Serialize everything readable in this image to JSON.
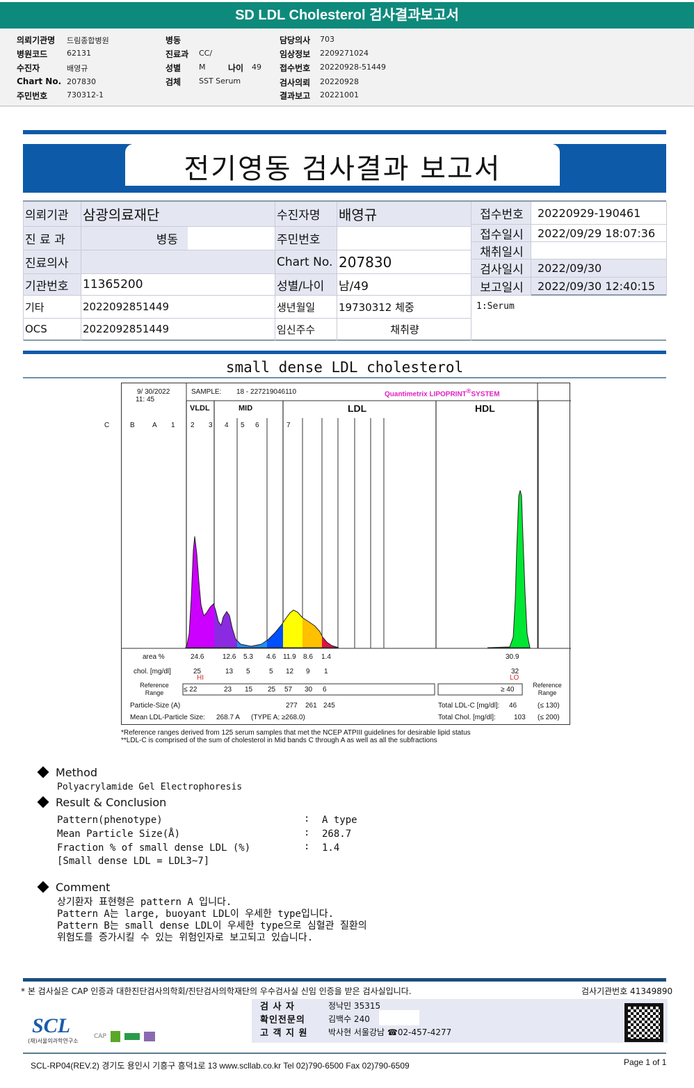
{
  "header": {
    "title": "SD LDL Cholesterol 검사결과보고서"
  },
  "meta": {
    "col1": [
      {
        "label": "의뢰기관명",
        "value": "드림종합병원"
      },
      {
        "label": "병원코드",
        "value": "62131"
      },
      {
        "label": "수진자",
        "value": "배영규"
      },
      {
        "label": "Chart No.",
        "value": "207830"
      },
      {
        "label": "주민번호",
        "value": "730312-1"
      }
    ],
    "col2": [
      {
        "label": "병동",
        "value": ""
      },
      {
        "label": "진료과",
        "value": "CC/"
      },
      {
        "label": "성별",
        "value": "M"
      },
      {
        "label": "검체",
        "value": "SST Serum"
      }
    ],
    "age": {
      "label": "나이",
      "value": "49"
    },
    "col3": [
      {
        "label": "담당의사",
        "value": "703"
      },
      {
        "label": "임상정보",
        "value": "2209271024"
      },
      {
        "label": "접수번호",
        "value": "20220928-51449"
      },
      {
        "label": "검사의뢰",
        "value": "20220928"
      },
      {
        "label": "결과보고",
        "value": "20221001"
      }
    ]
  },
  "report": {
    "title": "전기영동 검사결과 보고서"
  },
  "info": {
    "rows": [
      {
        "l1": "의뢰기관",
        "v1": "삼광의료재단",
        "l2": "수진자명",
        "v2": "배영규"
      },
      {
        "l1": "진 료 과",
        "v1": "병동",
        "l2": "주민번호",
        "v2": ""
      },
      {
        "l1": "진료의사",
        "v1": "",
        "l2": "Chart No.",
        "v2": "207830"
      },
      {
        "l1": "기관번호",
        "v1": "11365200",
        "l2": "성별/나이",
        "v2": "남/49"
      },
      {
        "l1": "기타",
        "v1": "2022092851449",
        "l2": "생년월일",
        "v2": "19730312 체중"
      },
      {
        "l1": "OCS",
        "v1": "2022092851449",
        "l2": "임신주수",
        "v2": "채취량"
      }
    ],
    "right": [
      {
        "label": "접수번호",
        "value": "20220929-190461"
      },
      {
        "label": "접수일시",
        "value": "2022/09/29 18:07:36"
      },
      {
        "label": "채취일시",
        "value": ""
      },
      {
        "label": "검사일시",
        "value": "2022/09/30"
      },
      {
        "label": "보고일시",
        "value": "2022/09/30 12:40:15"
      }
    ],
    "specimen": "1:Serum"
  },
  "section_title": "small dense LDL cholesterol",
  "chart_data": {
    "type": "area",
    "datetime": "9/ 30/2022",
    "time": "11: 45",
    "sample_label": "SAMPLE:",
    "sample": "18 - 227219046110",
    "brand": "Quantimetrix LIPOPRINT",
    "brand_mark": "®",
    "brand_suffix": "SYSTEM",
    "groups": [
      "VLDL",
      "MID",
      "LDL",
      "HDL"
    ],
    "bands": [
      "C",
      "B",
      "A",
      "1",
      "2",
      "3",
      "4",
      "5",
      "6",
      "7"
    ],
    "band_colors": {
      "VLDL": "#cc00ff",
      "MID-C": "#8a2be2",
      "MID-B": "#1e90ff",
      "MID-A": "#0050ff",
      "LDL1": "#ffff00",
      "LDL2": "#ffc000",
      "LDL3": "#e0104a",
      "HDL": "#00e632"
    },
    "rows": {
      "area_label": "area %",
      "area": [
        "24.6",
        "12.6",
        "5.3",
        "4.6",
        "11.9",
        "8.6",
        "1.4"
      ],
      "area_hdl": "30.9",
      "chol_label": "chol. [mg/dl]",
      "chol": [
        "25",
        "13",
        "5",
        "5",
        "12",
        "9",
        "1"
      ],
      "chol_hdl": "32",
      "flag_vldl": "HI",
      "flag_hdl": "LO",
      "ref_label": "Reference Range",
      "ref": [
        "≤ 22",
        "23",
        "15",
        "25",
        "57",
        "30",
        "6"
      ],
      "ref_hdl": "≥  40",
      "particle_label": "Particle-Size (A)",
      "particle": [
        "277",
        "261",
        "245"
      ],
      "mean_label": "Mean LDL-Particle Size:",
      "mean_value": "268.7  A",
      "mean_type": "(TYPE A; ≥268.0)",
      "total_ldl_label": "Total LDL-C  [mg/dl]:",
      "total_ldl": "46",
      "total_ldl_ref": "(≤ 130)",
      "total_chol_label": "Total Chol.  [mg/dl]:",
      "total_chol": "103",
      "total_chol_ref": "(≤ 200)"
    },
    "notes": [
      "*Reference ranges derived from 125 serum samples that met the NCEP ATPIII guidelines for desirable lipid status",
      "**LDL-C is comprised of the sum of cholesterol in Mid bands C through A as well as all the subfractions"
    ]
  },
  "method": {
    "title": "Method",
    "text": "Polyacrylamide Gel Electrophoresis"
  },
  "result": {
    "title": "Result & Conclusion",
    "items": [
      {
        "label": "Pattern(phenotype)",
        "value": "A type"
      },
      {
        "label": "Mean Particle Size(Å)",
        "value": "268.7"
      },
      {
        "label": "Fraction % of small dense LDL (%)",
        "value": "1.4"
      }
    ],
    "note": "[Small dense LDL = LDL3~7]"
  },
  "comment": {
    "title": "Comment",
    "lines": [
      "상기환자 표현형은 pattern A 입니다.",
      "Pattern A는 large, buoyant LDL이 우세한 type입니다.",
      "Pattern B는 small dense LDL이 우세한 type으로 심혈관 질환의",
      "위험도를 증가시킬 수 있는 위험인자로 보고되고 있습니다."
    ]
  },
  "footer": {
    "cert": "* 본 검사실은 CAP 인증과 대한진단검사의학회/진단검사의학재단의 우수검사실 신임 인증을 받은 검사실입니다.",
    "lab_no": "검사기관번호 41349890",
    "staff": [
      {
        "label": "검   사   자",
        "value": "정낙민 35315"
      },
      {
        "label": "확인전문의",
        "value": "김백수 240"
      },
      {
        "label": "고 객 지 원",
        "value": "박사현 서울강남 ☎02-457-4277"
      }
    ],
    "logo": "SCL",
    "logo_sub": "(재)서울의과학연구소",
    "address": "SCL-RP04(REV.2)  경기도 용인시 기흥구 흥덕1로 13  www.scllab.co.kr   Tel 02)790-6500   Fax 02)790-6509",
    "page": "Page 1 of 1"
  }
}
